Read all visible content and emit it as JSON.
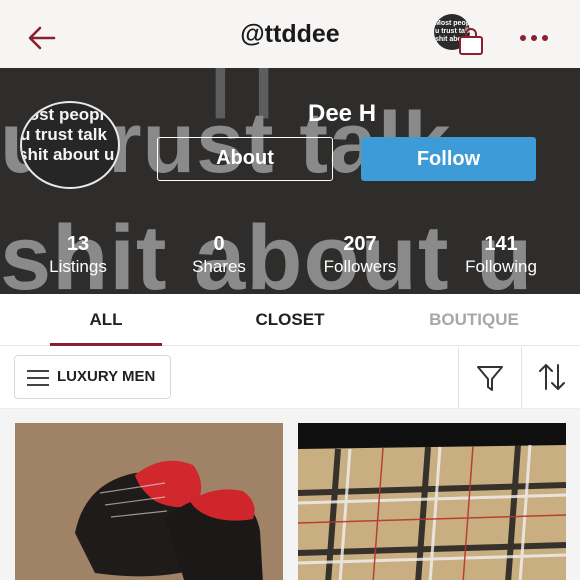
{
  "header": {
    "username": "@ttddee",
    "avatar_text": "Most peopl\nu trust talk\nshit about u"
  },
  "profile": {
    "avatar_text": [
      "lost peopl",
      "u trust talk",
      "shit about u"
    ],
    "cover_text": [
      "| |",
      "u trust talk",
      "shit about u"
    ],
    "name": "Dee H",
    "about_label": "About",
    "follow_label": "Follow",
    "stats": [
      {
        "value": "13",
        "label": "Listings"
      },
      {
        "value": "0",
        "label": "Shares"
      },
      {
        "value": "207",
        "label": "Followers"
      },
      {
        "value": "141",
        "label": "Following"
      }
    ]
  },
  "tabs": [
    {
      "label": "ALL",
      "active": true
    },
    {
      "label": "CLOSET",
      "active": false
    },
    {
      "label": "BOUTIQUE",
      "active": false
    }
  ],
  "filters": {
    "department_label": "LUXURY MEN"
  },
  "colors": {
    "accent": "#8a1f2e",
    "follow_button": "#3d9bd8",
    "cover_bg": "#2e2d2c"
  },
  "icons": {
    "back": "back-arrow-icon",
    "bag": "shopping-bag-icon",
    "more": "more-dots-icon",
    "menu": "hamburger-menu-icon",
    "filter": "funnel-filter-icon",
    "sort": "sort-arrows-icon"
  }
}
